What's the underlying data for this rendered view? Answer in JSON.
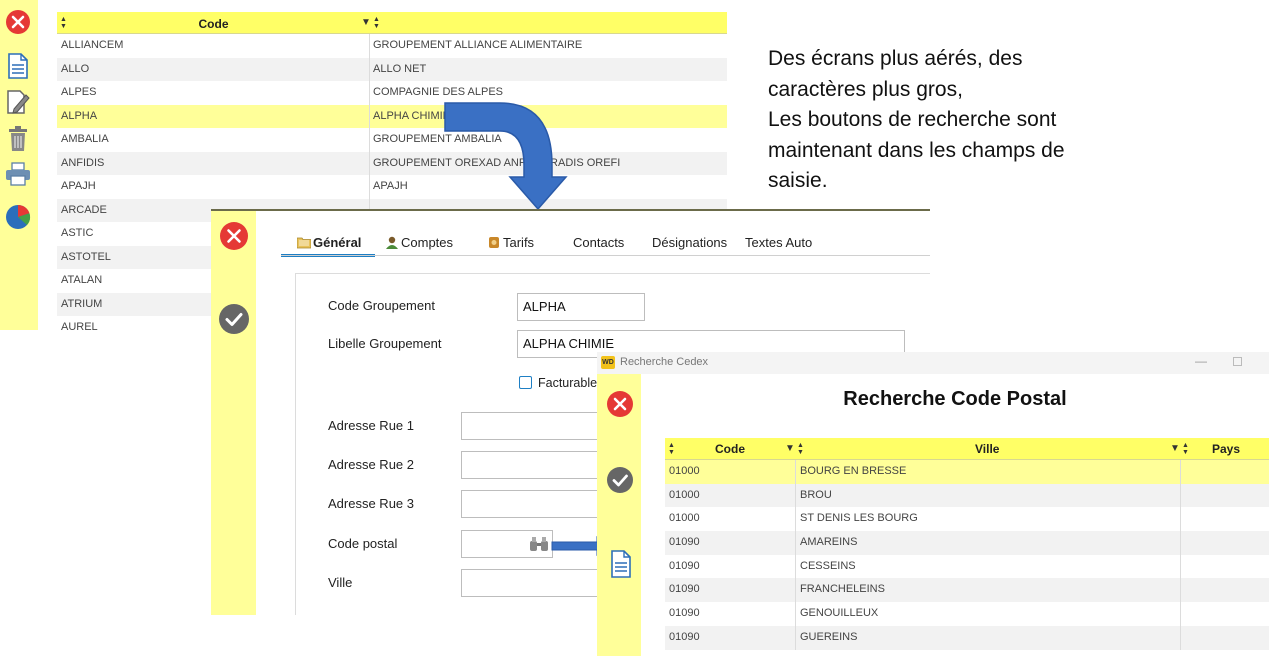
{
  "list_window": {
    "grid": {
      "header_code": "Code",
      "rows": [
        {
          "code": "ALLIANCEM",
          "label": "GROUPEMENT ALLIANCE ALIMENTAIRE"
        },
        {
          "code": "ALLO",
          "label": "ALLO NET"
        },
        {
          "code": "ALPES",
          "label": "COMPAGNIE DES ALPES"
        },
        {
          "code": "ALPHA",
          "label": "ALPHA CHIMIE",
          "selected": true
        },
        {
          "code": "AMBALIA",
          "label": "GROUPEMENT AMBALIA"
        },
        {
          "code": "ANFIDIS",
          "label": "GROUPEMENT OREXAD ANFIDIS RADIS OREFI"
        },
        {
          "code": "APAJH",
          "label": "APAJH"
        },
        {
          "code": "ARCADE",
          "label": ""
        },
        {
          "code": "ASTIC",
          "label": ""
        },
        {
          "code": "ASTOTEL",
          "label": ""
        },
        {
          "code": "ATALAN",
          "label": ""
        },
        {
          "code": "ATRIUM",
          "label": ""
        },
        {
          "code": "AUREL",
          "label": ""
        }
      ]
    },
    "sidebar_icons": [
      "close-icon",
      "document-icon",
      "edit-icon",
      "trash-icon",
      "print-icon",
      "pie-chart-icon"
    ]
  },
  "caption": {
    "lines": [
      "Des écrans plus aérés, des",
      "caractères plus gros,",
      "Les boutons de recherche sont",
      "maintenant dans les champs de",
      "saisie."
    ]
  },
  "form_window": {
    "tabs": [
      {
        "label": "Général",
        "icon": "folder-icon",
        "active": true
      },
      {
        "label": "Comptes",
        "icon": "users-icon"
      },
      {
        "label": "Tarifs",
        "icon": "tag-icon"
      },
      {
        "label": "Contacts"
      },
      {
        "label": "Désignations"
      },
      {
        "label": "Textes Auto"
      }
    ],
    "fields": {
      "code_groupement_label": "Code Groupement",
      "code_groupement_value": "ALPHA",
      "libelle_label": "Libelle Groupement",
      "libelle_value": "ALPHA CHIMIE",
      "facturable_label": "Facturable",
      "adresse1_label": "Adresse Rue 1",
      "adresse2_label": "Adresse Rue 2",
      "adresse3_label": "Adresse Rue 3",
      "code_postal_label": "Code postal",
      "ville_label": "Ville"
    },
    "colors": {
      "tab_accent": "#1e7fc4",
      "sidebar": "#ffff99"
    }
  },
  "search_window": {
    "window_title": "Recherche Cedex",
    "app_badge": "WD",
    "heading": "Recherche Code Postal",
    "headers": {
      "code": "Code",
      "ville": "Ville",
      "pays": "Pays"
    },
    "rows": [
      {
        "code": "01000",
        "ville": "BOURG EN BRESSE",
        "selected": true
      },
      {
        "code": "01000",
        "ville": "BROU"
      },
      {
        "code": "01000",
        "ville": "ST DENIS LES BOURG"
      },
      {
        "code": "01090",
        "ville": "AMAREINS"
      },
      {
        "code": "01090",
        "ville": "CESSEINS"
      },
      {
        "code": "01090",
        "ville": "FRANCHELEINS"
      },
      {
        "code": "01090",
        "ville": "GENOUILLEUX"
      },
      {
        "code": "01090",
        "ville": "GUEREINS"
      }
    ]
  }
}
